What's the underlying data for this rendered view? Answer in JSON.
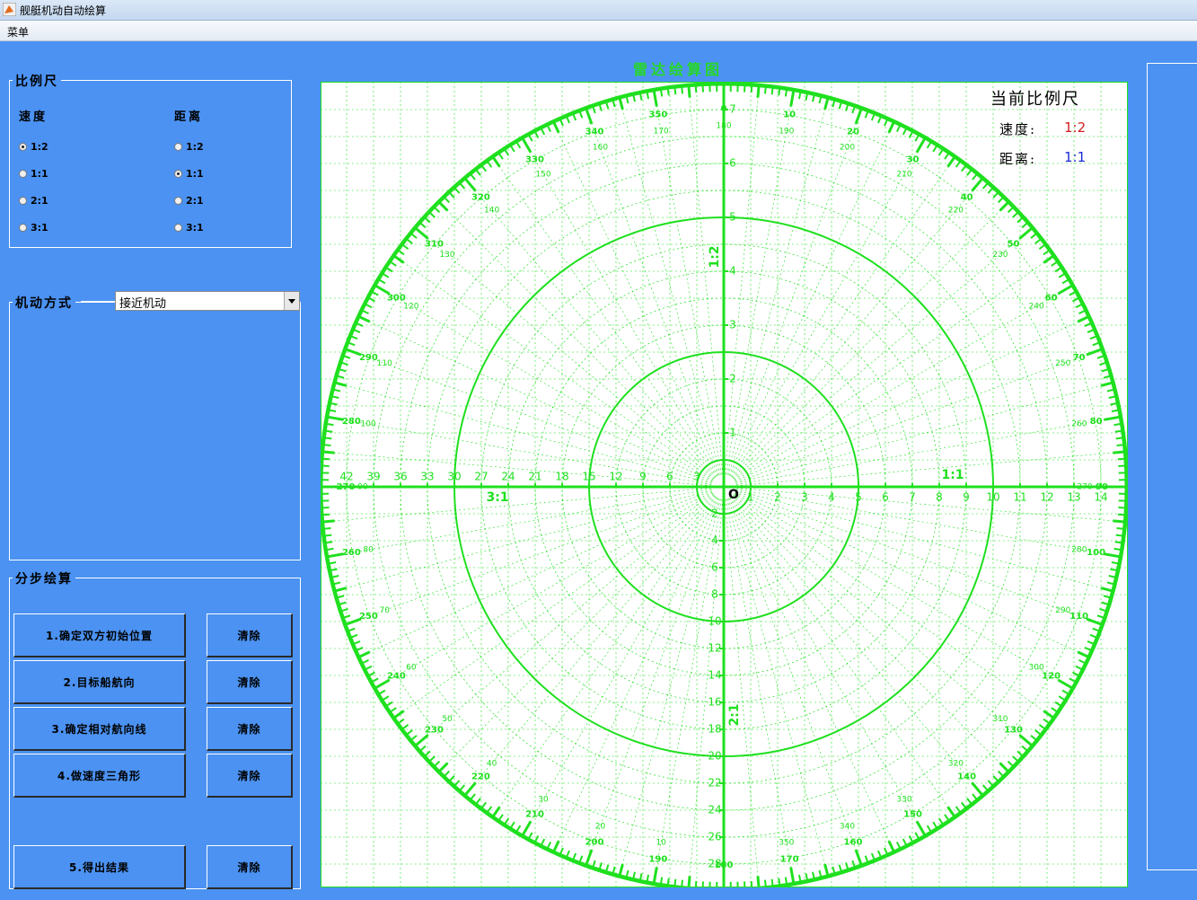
{
  "window": {
    "title": "舰艇机动自动绘算"
  },
  "menu": {
    "items": [
      "菜单"
    ]
  },
  "scale_panel": {
    "title": "比例尺",
    "speed_label": "速度",
    "distance_label": "距离",
    "speed_options": [
      "1:2",
      "1:1",
      "2:1",
      "3:1"
    ],
    "speed_selected": "1:2",
    "distance_options": [
      "1:2",
      "1:1",
      "2:1",
      "3:1"
    ],
    "distance_selected": "1:1"
  },
  "maneuver_panel": {
    "title": "机动方式",
    "selected": "接近机动"
  },
  "steps_panel": {
    "title": "分步绘算",
    "steps": [
      {
        "label": "1.确定双方初始位置",
        "clear": "清除"
      },
      {
        "label": "2.目标船航向",
        "clear": "清除"
      },
      {
        "label": "3.确定相对航向线",
        "clear": "清除"
      },
      {
        "label": "4.做速度三角形",
        "clear": "清除"
      },
      {
        "label": "5.得出结果",
        "clear": "清除"
      }
    ]
  },
  "chart": {
    "title": "雷达绘算图",
    "current_scale_title": "当前比例尺",
    "speed_label": "速度:",
    "speed_value": "1:2",
    "speed_color": "#d42020",
    "distance_label": "距离:",
    "distance_value": "1:1",
    "distance_color": "#1a2bd6",
    "grid_color": "#1fe01f",
    "center_label": "O",
    "scale_labels": {
      "right": "1:1",
      "left": "3:1",
      "up": "1:2",
      "down": "2:1"
    }
  },
  "chart_data": {
    "type": "polar-plotting-sheet",
    "bearing_outer_labels": [
      0,
      10,
      20,
      30,
      40,
      50,
      60,
      70,
      80,
      90,
      100,
      110,
      120,
      130,
      140,
      150,
      160,
      170,
      180,
      190,
      200,
      210,
      220,
      230,
      240,
      250,
      260,
      270,
      280,
      290,
      300,
      310,
      320,
      330,
      340,
      350
    ],
    "bearing_inner_labels": [
      10,
      20,
      30,
      40,
      50,
      60,
      70,
      80,
      90,
      100,
      110,
      120,
      130,
      140,
      150,
      160,
      170,
      180,
      190,
      200,
      210,
      220,
      230,
      240,
      250,
      260,
      270,
      280,
      290,
      300,
      310,
      320,
      330,
      340,
      350
    ],
    "ring_radii_units": [
      1,
      5,
      10,
      15
    ],
    "axis_right_ticks": [
      1,
      2,
      3,
      4,
      5,
      6,
      7,
      8,
      9,
      10,
      11,
      12,
      13,
      14
    ],
    "axis_left_ticks": [
      3,
      6,
      9,
      12,
      15,
      18,
      21,
      24,
      27,
      30,
      33,
      36,
      39,
      42
    ],
    "axis_up_ticks": [
      1,
      2,
      3,
      4,
      5,
      6,
      7
    ],
    "axis_down_ticks": [
      2,
      4,
      6,
      8,
      10,
      12,
      14,
      16,
      18,
      20,
      22,
      24,
      26,
      28
    ]
  }
}
